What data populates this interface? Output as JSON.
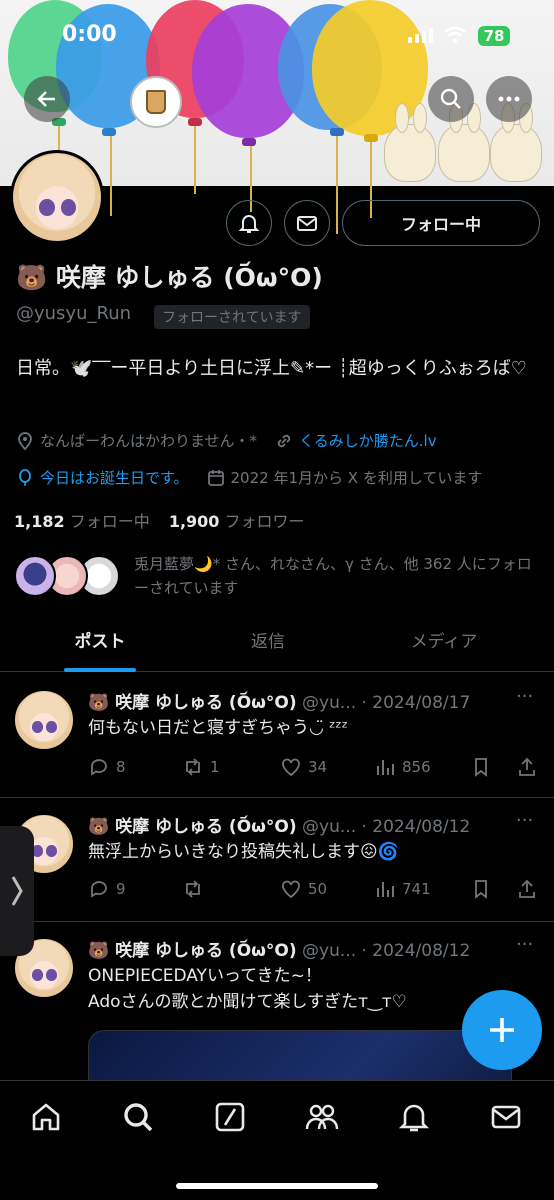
{
  "status_bar": {
    "time": "0:00",
    "battery": "78"
  },
  "profile": {
    "name": "🐻 咲摩 ゆしゅる (O᷄ω°O)",
    "handle": "@yusyu_Run",
    "follows_you": "フォローされています",
    "bio": "日常。🕊️‾‾ー平日より土日に浮上✎*ー ┊超ゆっくりふぉろば♡",
    "location": "なんばーわんはかわりません・*",
    "website": "くるみしか勝たん.lv",
    "birthday": "今日はお誕生日です。",
    "joined": "2022 年1月から X を利用しています",
    "following_count": "1,182",
    "following_label": "フォロー中",
    "followers_count": "1,900",
    "followers_label": "フォロワー",
    "followed_by": "兎月藍夢🌙* さん、れなさん、γ さん、他 362 人にフォローされています"
  },
  "actions": {
    "follow_button": "フォロー中"
  },
  "tabs": [
    {
      "label": "ポスト",
      "active": true
    },
    {
      "label": "返信",
      "active": false
    },
    {
      "label": "メディア",
      "active": false
    }
  ],
  "posts": [
    {
      "author": "🐻 咲摩 ゆしゅる (O᷄ω°O)",
      "meta": "@yu... · 2024/08/17",
      "text": "何もない日だと寝すぎちゃう◡̈ ᶻᶻᶻ",
      "replies": "8",
      "reposts": "1",
      "likes": "34",
      "views": "856"
    },
    {
      "author": "🐻 咲摩 ゆしゅる (O᷄ω°O)",
      "meta": "@yu... · 2024/08/12",
      "text": "無浮上からいきなり投稿失礼します😖🌀",
      "replies": "9",
      "reposts": "",
      "likes": "50",
      "views": "741"
    },
    {
      "author": "🐻 咲摩 ゆしゅる (O᷄ω°O)",
      "meta": "@yu... · 2024/08/12",
      "text": "ONEPIECEDAYいってきた~！",
      "text2": "Adoさんの歌とか聞けて楽しすぎたт‿т♡"
    }
  ],
  "icons": [
    "back-icon",
    "search-icon",
    "more-icon",
    "notify-icon",
    "mail-icon",
    "location-icon",
    "link-icon",
    "balloon-icon",
    "calendar-icon",
    "reply-icon",
    "repost-icon",
    "like-icon",
    "views-icon",
    "bookmark-icon",
    "share-icon",
    "home-icon",
    "grok-icon",
    "communities-icon",
    "bell-icon",
    "compose-icon"
  ],
  "colors": {
    "accent": "#1d9bf0",
    "bg": "#000000",
    "muted": "#71767b"
  }
}
